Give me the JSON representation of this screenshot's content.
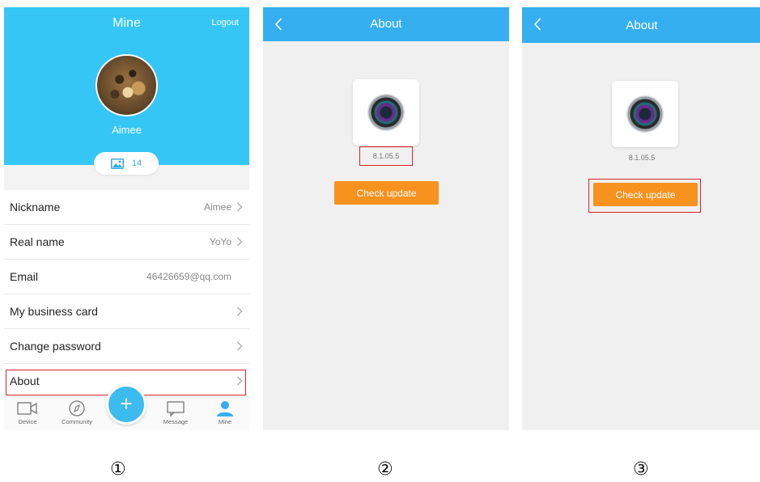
{
  "screen1": {
    "title": "Mine",
    "logout_label": "Logout",
    "profile_name": "Aimee",
    "photo_count": "14",
    "rows": [
      {
        "label": "Nickname",
        "value": "Aimee"
      },
      {
        "label": "Real name",
        "value": "YoYo"
      },
      {
        "label": "Email",
        "value": "46426659@qq.com"
      },
      {
        "label": "My business card",
        "value": ""
      },
      {
        "label": "Change password",
        "value": ""
      },
      {
        "label": "About",
        "value": ""
      }
    ],
    "tabs": [
      {
        "label": "Device",
        "icon": "video-camera-icon"
      },
      {
        "label": "Community",
        "icon": "compass-icon"
      },
      {
        "label": "Message",
        "icon": "message-icon"
      },
      {
        "label": "Mine",
        "icon": "person-icon"
      }
    ],
    "fab_label": "+"
  },
  "screen2": {
    "title": "About",
    "version": "8.1.05.5",
    "check_update_label": "Check update"
  },
  "screen3": {
    "title": "About",
    "version": "8.1.05.5",
    "check_update_label": "Check update"
  },
  "step_labels": [
    "①",
    "②",
    "③"
  ],
  "colors": {
    "header_blue": "#35c6f5",
    "topbar_blue": "#35aff0",
    "button_orange": "#f7921e",
    "highlight_red": "#d9232d"
  }
}
